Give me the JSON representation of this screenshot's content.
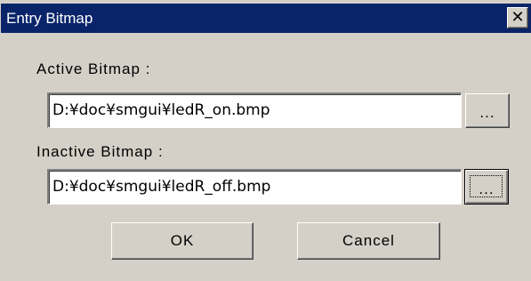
{
  "window": {
    "title": "Entry Bitmap",
    "close_glyph": "✕"
  },
  "active": {
    "label": "Active Bitmap :",
    "value": "D:¥doc¥smgui¥ledR_on.bmp",
    "browse_label": "..."
  },
  "inactive": {
    "label": "Inactive Bitmap :",
    "value": "D:¥doc¥smgui¥ledR_off.bmp",
    "browse_label": "..."
  },
  "buttons": {
    "ok": "OK",
    "cancel": "Cancel"
  },
  "colors": {
    "titlebar": "#0a246a",
    "face": "#d4d0c8"
  }
}
